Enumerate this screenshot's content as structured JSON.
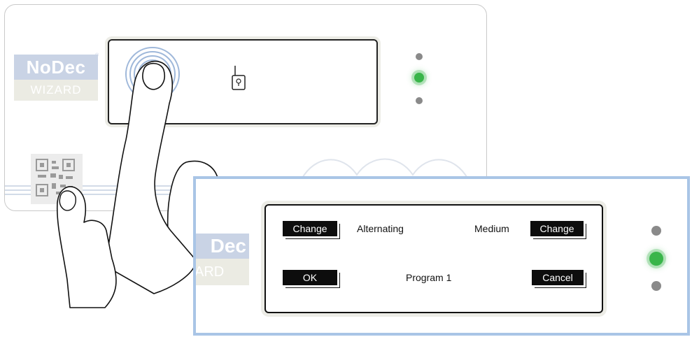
{
  "device": {
    "logo_top": "NoDec",
    "logo_bottom": "WIZARD",
    "logo_registered": "®"
  },
  "zoom": {
    "logo_top_partial": "Dec",
    "logo_bottom_partial": "ARD",
    "buttons": {
      "change_left": "Change",
      "change_right": "Change",
      "ok": "OK",
      "cancel": "Cancel"
    },
    "labels": {
      "mode": "Alternating",
      "intensity": "Medium",
      "program": "Program 1"
    }
  },
  "leds": {
    "top": "off",
    "middle": "on",
    "bottom": "off"
  },
  "colors": {
    "accent_frame": "#a9c5e6",
    "led_on": "#39b54a",
    "led_off": "#8a8a8a",
    "logo_blue": "#c9d3e5",
    "logo_beige": "#ebebe3"
  },
  "icons": [
    "qr-code-icon",
    "fingerprint-rings-icon",
    "lock-icon",
    "hand-pointing-icon"
  ]
}
